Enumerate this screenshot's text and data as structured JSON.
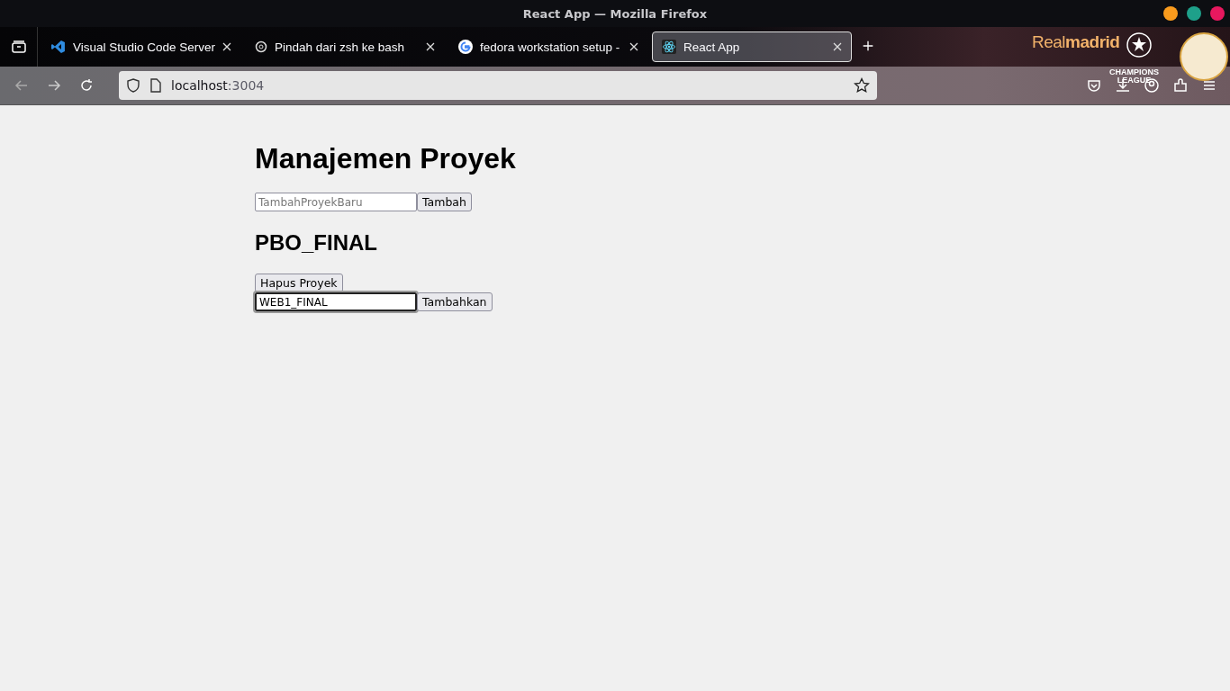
{
  "window": {
    "title": "React App — Mozilla Firefox"
  },
  "tabs": [
    {
      "label": "Visual Studio Code Server",
      "kind": "vscode",
      "selected": false
    },
    {
      "label": "Pindah dari zsh ke bash",
      "kind": "chat",
      "selected": false
    },
    {
      "label": "fedora workstation setup -",
      "kind": "google",
      "selected": false
    },
    {
      "label": "React App",
      "kind": "react",
      "selected": true
    }
  ],
  "theme": {
    "brand": "Real**madrid**",
    "badge_line_1": "CHAMPIONS",
    "badge_line_2": "LEAGUE"
  },
  "address_bar": {
    "host": "localhost",
    "port": ":3004"
  },
  "page": {
    "heading": "Manajemen Proyek",
    "new_project": {
      "placeholder": "TambahProyekBaru",
      "button": "Tambah"
    },
    "projects": [
      {
        "name": "PBO_FINAL",
        "delete_button": "Hapus Proyek",
        "task_input": {
          "value": "WEB1_FINAL",
          "focused": true
        },
        "add_button": "Tambahkan"
      }
    ]
  }
}
